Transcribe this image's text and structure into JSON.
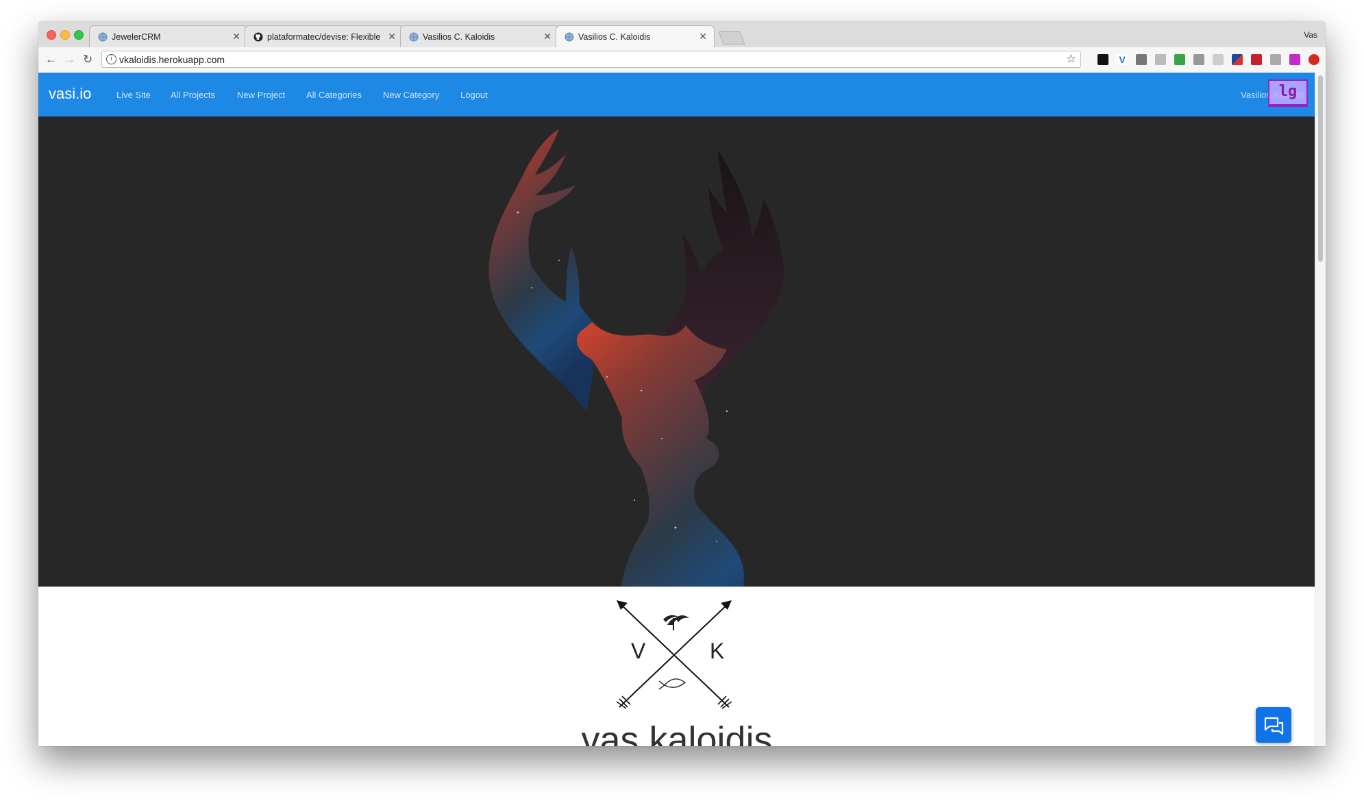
{
  "browser": {
    "profile_name": "Vas",
    "tabs": [
      {
        "title": "JewelerCRM",
        "icon": "globe-icon"
      },
      {
        "title": "plataformatec/devise: Flexible",
        "icon": "github-icon"
      },
      {
        "title": "Vasilios C. Kaloidis",
        "icon": "globe-icon"
      },
      {
        "title": "Vasilios C. Kaloidis",
        "icon": "globe-icon",
        "active": true
      }
    ],
    "url": "vkaloidis.herokuapp.com"
  },
  "site": {
    "brand": "vasi.io",
    "nav": [
      "Live Site",
      "All Projects",
      "New Project",
      "All Categories",
      "New Category",
      "Logout"
    ],
    "user": "Vasilios Kaloidis",
    "breakpoint_badge": "lg",
    "monogram_left": "V",
    "monogram_right": "K",
    "heading": "vas kaloidis"
  },
  "colors": {
    "navbar": "#1e88e5",
    "hero_bg": "#272727",
    "chat_button": "#1173e8",
    "badge_border": "#a020c0"
  }
}
